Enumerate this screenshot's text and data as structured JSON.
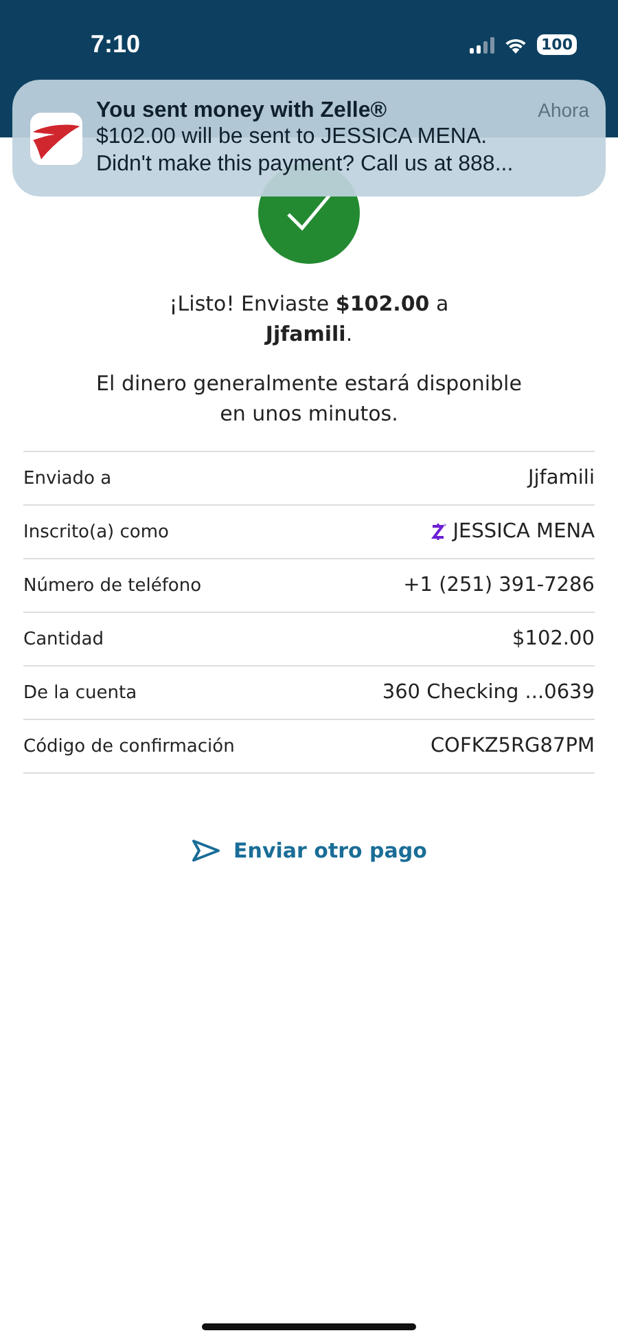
{
  "status_bar": {
    "time": "7:10",
    "battery": "100"
  },
  "notification": {
    "title": "You sent money with Zelle®",
    "time": "Ahora",
    "lines": [
      "$102.00 will be sent to JESSICA MENA.",
      "Didn't make this payment? Call us at 888..."
    ]
  },
  "confirmation": {
    "headline": "¡Listo! Enviaste **$102.00** a **Jjfamili**.",
    "note": "El dinero generalmente estará disponible en unos minutos."
  },
  "details": [
    {
      "kind": "plain",
      "label": "Enviado a",
      "value": "Jjfamili"
    },
    {
      "kind": "enrolled",
      "label": "Inscrito(a) como",
      "value": "JESSICA MENA"
    },
    {
      "kind": "plain",
      "label": "Número de teléfono",
      "value": "+1 (251) 391-7286"
    },
    {
      "kind": "plain",
      "label": "Cantidad",
      "value": "$102.00"
    },
    {
      "kind": "plain",
      "label": "De la cuenta",
      "value": "360 Checking ...0639"
    },
    {
      "kind": "plain",
      "label": "Código de confirmación",
      "value": "COFKZ5RG87PM"
    }
  ],
  "send_another": {
    "label": "Enviar otro pago"
  }
}
